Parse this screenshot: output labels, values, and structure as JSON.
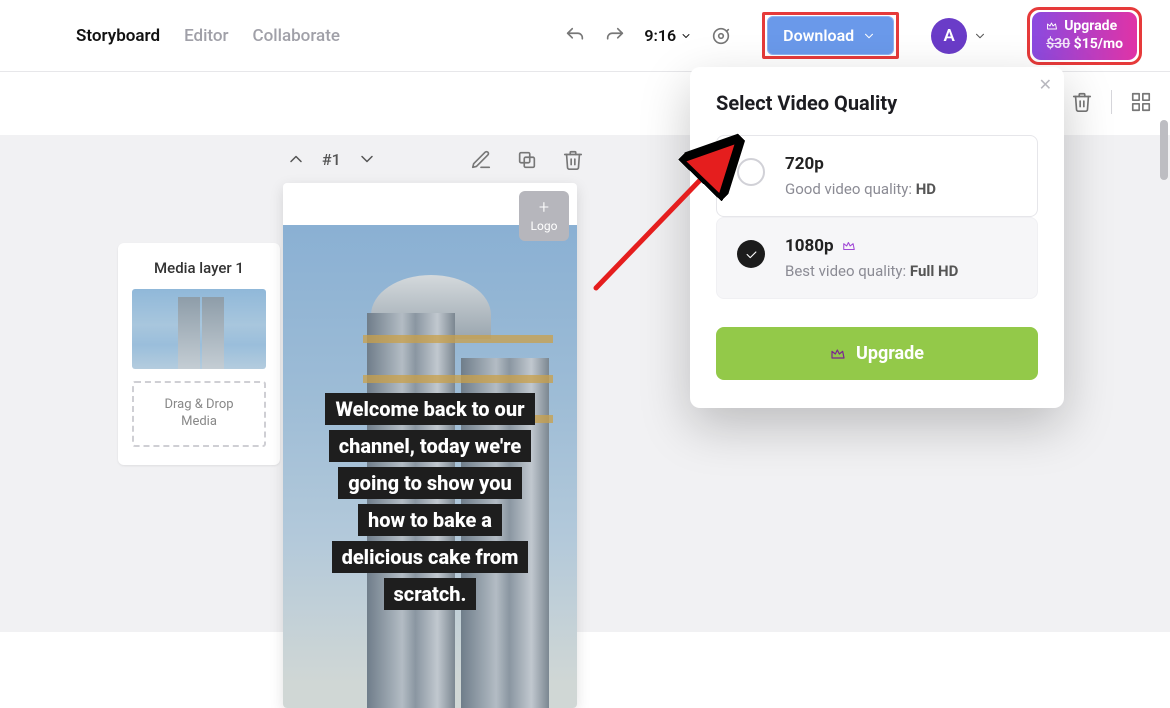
{
  "header": {
    "tabs": [
      "Storyboard",
      "Editor",
      "Collaborate"
    ],
    "time": "9:16",
    "download_label": "Download",
    "avatar_initial": "A",
    "upgrade": {
      "label": "Upgrade",
      "old_price": "$30",
      "new_price": "$15/mo"
    }
  },
  "scene": {
    "number": "#1",
    "logo_label": "Logo"
  },
  "media_panel": {
    "title": "Media layer 1",
    "drop_line1": "Drag & Drop",
    "drop_line2": "Media"
  },
  "caption_lines": [
    "Welcome back to our",
    "channel, today we're",
    "going to show you",
    "how to bake a",
    "delicious cake from",
    "scratch."
  ],
  "popover": {
    "title": "Select Video Quality",
    "options": [
      {
        "name": "720p",
        "desc_prefix": "Good video quality: ",
        "desc_bold": "HD",
        "premium": false,
        "selected": false
      },
      {
        "name": "1080p",
        "desc_prefix": "Best video quality: ",
        "desc_bold": "Full HD",
        "premium": true,
        "selected": true
      }
    ],
    "upgrade_label": "Upgrade"
  }
}
